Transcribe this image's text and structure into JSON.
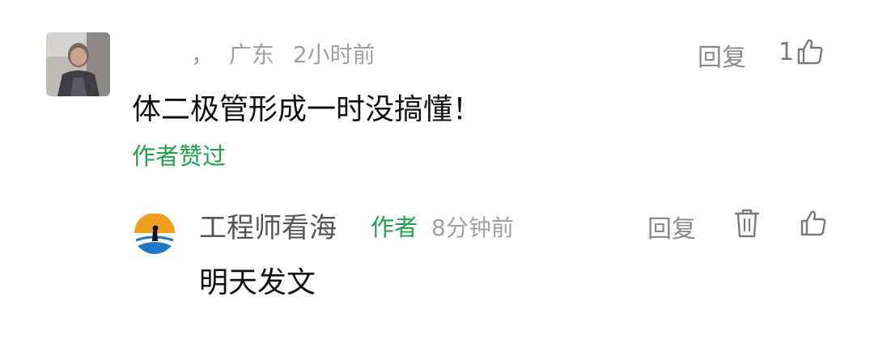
{
  "comment": {
    "location": "广东",
    "time": "2小时前",
    "name_fragment": "，",
    "reply_label": "回复",
    "like_count": "1",
    "text": "体二极管形成一时没搞懂！",
    "author_liked_label": "作者赞过"
  },
  "reply": {
    "name": "工程师看海",
    "author_badge": "作者",
    "time": "8分钟前",
    "reply_label": "回复",
    "text": "明天发文"
  },
  "icons": {
    "like": "thumbs-up-icon",
    "delete": "trash-icon"
  },
  "colors": {
    "accent_green": "#1fa34a",
    "meta_gray": "#a0a0a0",
    "author_logo_orange": "#f0a020",
    "author_logo_blue": "#1e78c8"
  }
}
